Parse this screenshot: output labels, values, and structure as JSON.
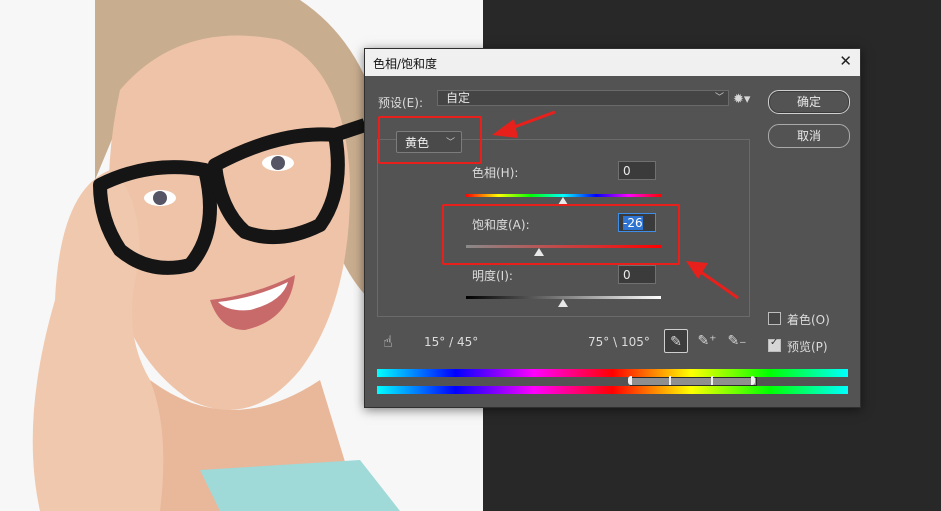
{
  "dialog": {
    "title": "色相/饱和度",
    "preset_label": "预设(E):",
    "preset_value": "自定",
    "ok_label": "确定",
    "cancel_label": "取消",
    "channel_value": "黄色",
    "hue": {
      "label": "色相(H):",
      "value": "0"
    },
    "saturation": {
      "label": "饱和度(A):",
      "value": "-26"
    },
    "lightness": {
      "label": "明度(I):",
      "value": "0"
    },
    "range_left": "15° / 45°",
    "range_right": "75° \\ 105°",
    "colorize": {
      "label": "着色(O)",
      "checked": false
    },
    "preview": {
      "label": "预览(P)",
      "checked": true
    }
  }
}
